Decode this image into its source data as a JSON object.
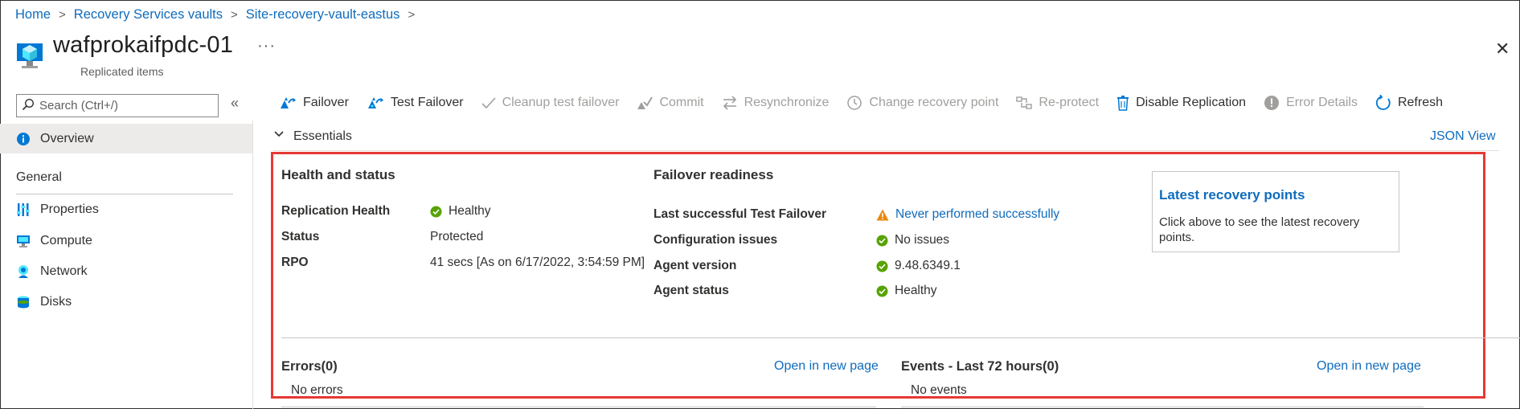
{
  "breadcrumb": {
    "items": [
      "Home",
      "Recovery Services vaults",
      "Site-recovery-vault-eastus"
    ],
    "separator": ">"
  },
  "header": {
    "title": "wafprokaifpdc-01",
    "subtitle": "Replicated items",
    "more_label": "···",
    "close_label": "✕"
  },
  "sidebar": {
    "search_placeholder": "Search (Ctrl+/)",
    "collapse_label": "«",
    "overview_label": "Overview",
    "section_label": "General",
    "items": [
      {
        "label": "Properties",
        "icon": "properties-icon"
      },
      {
        "label": "Compute",
        "icon": "compute-icon"
      },
      {
        "label": "Network",
        "icon": "network-icon"
      },
      {
        "label": "Disks",
        "icon": "disks-icon"
      }
    ]
  },
  "toolbar": {
    "items": [
      {
        "label": "Failover",
        "enabled": true,
        "icon": "failover-icon"
      },
      {
        "label": "Test Failover",
        "enabled": true,
        "icon": "test-failover-icon"
      },
      {
        "label": "Cleanup test failover",
        "enabled": false,
        "icon": "checkmark-icon"
      },
      {
        "label": "Commit",
        "enabled": false,
        "icon": "commit-icon"
      },
      {
        "label": "Resynchronize",
        "enabled": false,
        "icon": "resync-icon"
      },
      {
        "label": "Change recovery point",
        "enabled": false,
        "icon": "history-icon"
      },
      {
        "label": "Re-protect",
        "enabled": false,
        "icon": "reprotect-icon"
      },
      {
        "label": "Disable Replication",
        "enabled": true,
        "icon": "trash-icon"
      },
      {
        "label": "Error Details",
        "enabled": false,
        "icon": "error-icon"
      },
      {
        "label": "Refresh",
        "enabled": true,
        "icon": "refresh-icon"
      }
    ]
  },
  "essentials": {
    "label": "Essentials",
    "json_view": "JSON View",
    "health": {
      "title": "Health and status",
      "rows": [
        {
          "label": "Replication Health",
          "value": "Healthy",
          "status": "ok"
        },
        {
          "label": "Status",
          "value": "Protected",
          "status": "none"
        },
        {
          "label": "RPO",
          "value": "41 secs [As on 6/17/2022, 3:54:59 PM]",
          "status": "none"
        }
      ]
    },
    "failover": {
      "title": "Failover readiness",
      "rows": [
        {
          "label": "Last successful Test Failover",
          "value": "Never performed successfully",
          "status": "warning"
        },
        {
          "label": "Configuration issues",
          "value": "No issues",
          "status": "ok"
        },
        {
          "label": "Agent version",
          "value": "9.48.6349.1",
          "status": "ok"
        },
        {
          "label": "Agent status",
          "value": "Healthy",
          "status": "ok"
        }
      ]
    },
    "recovery_card": {
      "title": "Latest recovery points",
      "description": "Click above to see the latest recovery points."
    },
    "errors": {
      "title": "Errors(0)",
      "open_link": "Open in new page",
      "empty": "No errors"
    },
    "events": {
      "title": "Events - Last 72 hours(0)",
      "open_link": "Open in new page",
      "empty": "No events"
    }
  },
  "colors": {
    "link": "#0f6cbd",
    "ok": "#57a300",
    "warning": "#e8890c",
    "highlight_border": "#e53935"
  }
}
